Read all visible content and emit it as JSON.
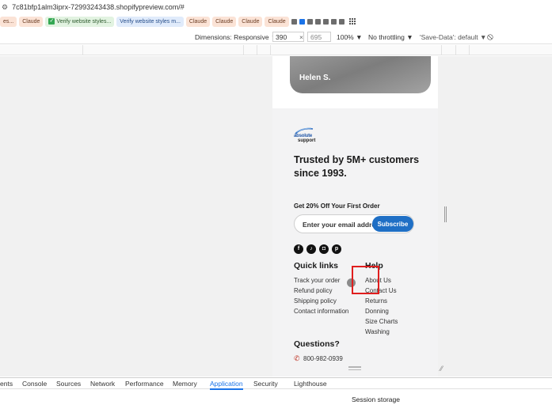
{
  "browser": {
    "url": "7c81bfp1alm3iprx-72993243438.shopifypreview.com/#",
    "bookmarks": [
      {
        "label": "es...",
        "style": "peach"
      },
      {
        "label": "Claude",
        "style": "peach"
      },
      {
        "label": "Verify website styles...",
        "style": "green"
      },
      {
        "label": "Verify website styles m...",
        "style": "blue"
      },
      {
        "label": "Claude",
        "style": "peach"
      },
      {
        "label": "Claude",
        "style": "peach"
      },
      {
        "label": "Claude",
        "style": "peach"
      },
      {
        "label": "Claude",
        "style": "peach"
      }
    ]
  },
  "device_toolbar": {
    "dimensions_label": "Dimensions: Responsive",
    "width": "390",
    "times": "×",
    "height": "695",
    "zoom": "100%",
    "throttle": "No throttling",
    "save_data": "'Save-Data': default"
  },
  "page": {
    "review_name": "Helen S.",
    "logo_line1": "absolute",
    "logo_line2": "support",
    "trusted": "Trusted by 5M+ customers since 1993.",
    "offer": "Get 20% Off Your First Order",
    "email_value": "Enter your email addre",
    "subscribe_label": "Subscribe",
    "socials": [
      "facebook-icon",
      "tiktok-icon",
      "instagram-icon",
      "pinterest-icon"
    ],
    "quick_links_title": "Quick links",
    "quick_links": [
      "Track your order",
      "Refund policy",
      "Shipping policy",
      "Contact information"
    ],
    "help_title": "Help",
    "help_links": [
      "About Us",
      "Contact Us",
      "Returns",
      "Donning",
      "Size Charts",
      "Washing"
    ],
    "questions_title": "Questions?",
    "phone": "800-982-0939"
  },
  "devtools": {
    "tabs": [
      "ents",
      "Console",
      "Sources",
      "Network",
      "Performance",
      "Memory",
      "Application",
      "Security",
      "Lighthouse"
    ],
    "active_tab": "Application",
    "panel_heading": "Session storage"
  },
  "colors": {
    "accent": "#1a73e8",
    "subscribe": "#1f6fc5",
    "highlight": "#e01e1e"
  }
}
